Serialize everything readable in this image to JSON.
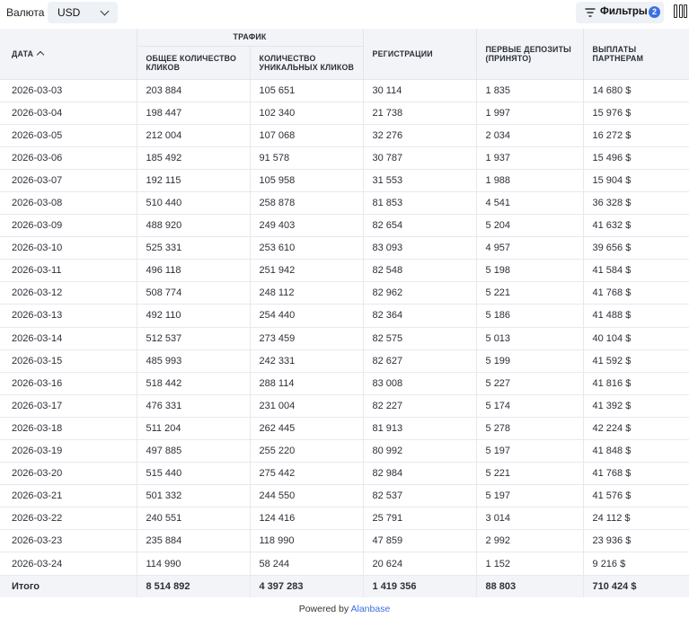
{
  "toolbar": {
    "currency_label": "Валюта",
    "currency_value": "USD",
    "filters_label": "Фильтры",
    "filters_count": "2"
  },
  "table": {
    "columns": {
      "date": "ДАТА",
      "traffic_group": "ТРАФИК",
      "total_clicks": "ОБЩЕЕ КОЛИЧЕСТВО КЛИКОВ",
      "unique_clicks": "КОЛИЧЕСТВО УНИКАЛЬНЫХ КЛИКОВ",
      "registrations": "РЕГИСТРАЦИИ",
      "first_deposits": "ПЕРВЫЕ ДЕПОЗИТЫ (ПРИНЯТО)",
      "payouts": "ВЫПЛАТЫ ПАРТНЕРАМ"
    },
    "rows": [
      [
        "2026-03-03",
        "203 884",
        "105 651",
        "30 114",
        "1 835",
        "14 680 $"
      ],
      [
        "2026-03-04",
        "198 447",
        "102 340",
        "21 738",
        "1 997",
        "15 976 $"
      ],
      [
        "2026-03-05",
        "212 004",
        "107 068",
        "32 276",
        "2 034",
        "16 272 $"
      ],
      [
        "2026-03-06",
        "185 492",
        "91 578",
        "30 787",
        "1 937",
        "15 496 $"
      ],
      [
        "2026-03-07",
        "192 115",
        "105 958",
        "31 553",
        "1 988",
        "15 904 $"
      ],
      [
        "2026-03-08",
        "510 440",
        "258 878",
        "81 853",
        "4 541",
        "36 328 $"
      ],
      [
        "2026-03-09",
        "488 920",
        "249 403",
        "82 654",
        "5 204",
        "41 632 $"
      ],
      [
        "2026-03-10",
        "525 331",
        "253 610",
        "83 093",
        "4 957",
        "39 656 $"
      ],
      [
        "2026-03-11",
        "496 118",
        "251 942",
        "82 548",
        "5 198",
        "41 584 $"
      ],
      [
        "2026-03-12",
        "508 774",
        "248 112",
        "82 962",
        "5 221",
        "41 768 $"
      ],
      [
        "2026-03-13",
        "492 110",
        "254 440",
        "82 364",
        "5 186",
        "41 488 $"
      ],
      [
        "2026-03-14",
        "512 537",
        "273 459",
        "82 575",
        "5 013",
        "40 104 $"
      ],
      [
        "2026-03-15",
        "485 993",
        "242 331",
        "82 627",
        "5 199",
        "41 592 $"
      ],
      [
        "2026-03-16",
        "518 442",
        "288 114",
        "83 008",
        "5 227",
        "41 816 $"
      ],
      [
        "2026-03-17",
        "476 331",
        "231 004",
        "82 227",
        "5 174",
        "41 392 $"
      ],
      [
        "2026-03-18",
        "511 204",
        "262 445",
        "81 913",
        "5 278",
        "42 224 $"
      ],
      [
        "2026-03-19",
        "497 885",
        "255 220",
        "80 992",
        "5 197",
        "41 848 $"
      ],
      [
        "2026-03-20",
        "515 440",
        "275 442",
        "82 984",
        "5 221",
        "41 768 $"
      ],
      [
        "2026-03-21",
        "501 332",
        "244 550",
        "82 537",
        "5 197",
        "41 576 $"
      ],
      [
        "2026-03-22",
        "240 551",
        "124 416",
        "25 791",
        "3 014",
        "24 112 $"
      ],
      [
        "2026-03-23",
        "235 884",
        "118 990",
        "47 859",
        "2 992",
        "23 936 $"
      ],
      [
        "2026-03-24",
        "114 990",
        "58 244",
        "20 624",
        "1 152",
        "9 216 $"
      ]
    ],
    "totals": [
      "Итого",
      "8 514 892",
      "4 397 283",
      "1 419 356",
      "88 803",
      "710 424 $"
    ]
  },
  "footer": {
    "powered_by": "Powered by",
    "brand": "Alanbase"
  }
}
